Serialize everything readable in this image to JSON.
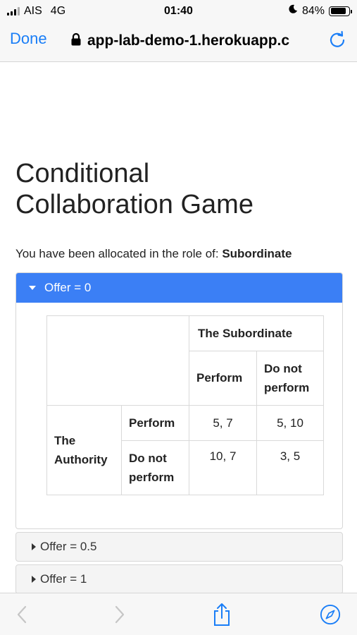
{
  "status_bar": {
    "carrier": "AIS",
    "network": "4G",
    "time": "01:40",
    "battery": "84%",
    "battery_level": 0.84
  },
  "nav": {
    "done_label": "Done",
    "url": "app-lab-demo-1.herokuapp.c",
    "icons": [
      "lock-icon",
      "reload-icon"
    ]
  },
  "page": {
    "title_line1": "Conditional",
    "title_line2": "Collaboration Game",
    "role_prefix": "You have been allocated in the role of: ",
    "role": "Subordinate"
  },
  "offers": [
    {
      "label": "Offer = 0",
      "expanded": true
    },
    {
      "label": "Offer = 0.5",
      "expanded": false
    },
    {
      "label": "Offer = 1",
      "expanded": false
    }
  ],
  "payoff_table": {
    "column_player": "The Subordinate",
    "column_actions": [
      "Perform",
      "Do not perform"
    ],
    "row_player": "The Authority",
    "row_actions": [
      "Perform",
      "Do not perform"
    ],
    "cells": [
      [
        "5, 7",
        "5, 10"
      ],
      [
        "10, 7",
        "3, 5"
      ]
    ]
  },
  "toolbar": {
    "icons": [
      "back-icon",
      "forward-icon",
      "share-icon",
      "compass-icon"
    ]
  },
  "colors": {
    "accent": "#3b7ff5",
    "ios_blue": "#1a7ef7"
  }
}
